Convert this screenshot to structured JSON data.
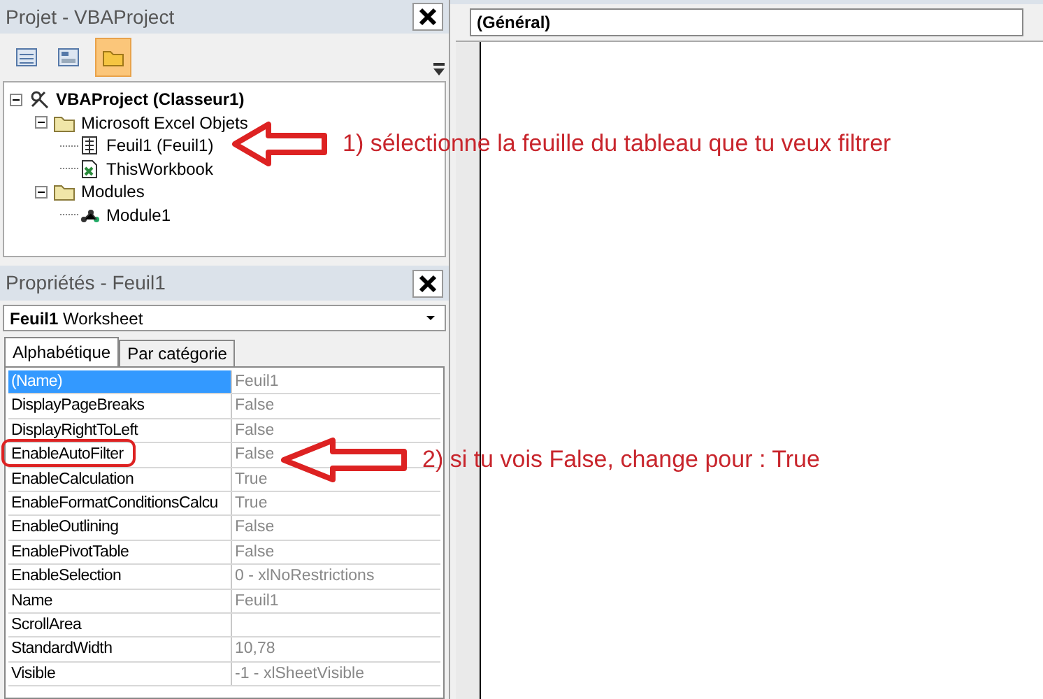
{
  "project_pane": {
    "title": "Projet - VBAProject",
    "toolbar": [
      {
        "kind": "code",
        "selected": false
      },
      {
        "kind": "form",
        "selected": false
      },
      {
        "kind": "folders",
        "selected": true
      }
    ],
    "tree": [
      {
        "label": "VBAProject (Classeur1)",
        "kind": "project",
        "expanded": true,
        "children": [
          {
            "label": "Microsoft Excel Objets",
            "kind": "folder",
            "expanded": true,
            "children": [
              {
                "label": "Feuil1 (Feuil1)",
                "kind": "sheet"
              },
              {
                "label": "ThisWorkbook",
                "kind": "workbook"
              }
            ]
          },
          {
            "label": "Modules",
            "kind": "folder",
            "expanded": true,
            "children": [
              {
                "label": "Module1",
                "kind": "module"
              }
            ]
          }
        ]
      }
    ]
  },
  "properties_pane": {
    "title": "Propriétés - Feuil1",
    "object": {
      "name": "Feuil1",
      "type": "Worksheet"
    },
    "tabs": [
      {
        "label": "Alphabétique",
        "selected": true
      },
      {
        "label": "Par catégorie",
        "selected": false
      }
    ],
    "rows": [
      {
        "name": "(Name)",
        "value": "Feuil1",
        "selected": true
      },
      {
        "name": "DisplayPageBreaks",
        "value": "False",
        "selected": false
      },
      {
        "name": "DisplayRightToLeft",
        "value": "False",
        "selected": false
      },
      {
        "name": "EnableAutoFilter",
        "value": "False",
        "selected": false
      },
      {
        "name": "EnableCalculation",
        "value": "True",
        "selected": false
      },
      {
        "name": "EnableFormatConditionsCalcu",
        "value": "True",
        "selected": false
      },
      {
        "name": "EnableOutlining",
        "value": "False",
        "selected": false
      },
      {
        "name": "EnablePivotTable",
        "value": "False",
        "selected": false
      },
      {
        "name": "EnableSelection",
        "value": "0 - xlNoRestrictions",
        "selected": false
      },
      {
        "name": "Name",
        "value": "Feuil1",
        "selected": false
      },
      {
        "name": "ScrollArea",
        "value": "",
        "selected": false
      },
      {
        "name": "StandardWidth",
        "value": "10,78",
        "selected": false
      },
      {
        "name": "Visible",
        "value": "-1 - xlSheetVisible",
        "selected": false
      }
    ]
  },
  "code_pane": {
    "object_dropdown": "(Général)"
  },
  "annotations": [
    {
      "text": "1) sélectionne la feuille du tableau que tu veux filtrer"
    },
    {
      "text": "2) si tu vois False, change pour : True"
    }
  ]
}
